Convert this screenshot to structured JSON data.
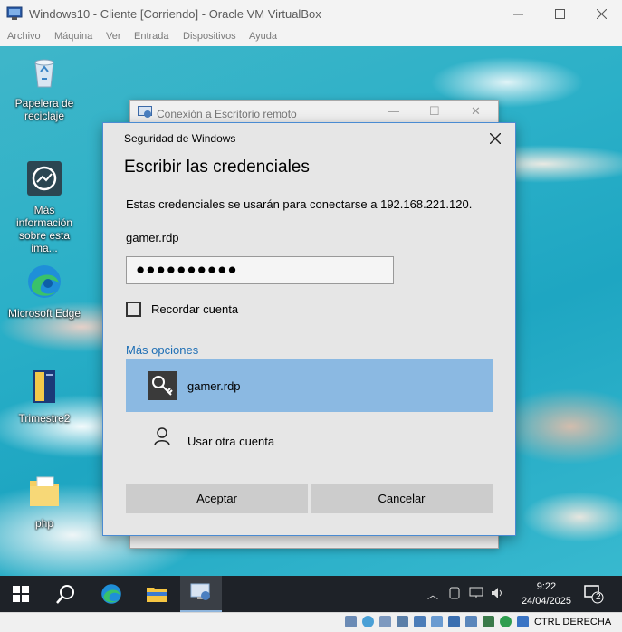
{
  "vbox": {
    "title": "Windows10 - Cliente [Corriendo] - Oracle VM VirtualBox",
    "menu": [
      "Archivo",
      "Máquina",
      "Ver",
      "Entrada",
      "Dispositivos",
      "Ayuda"
    ],
    "status_label": "CTRL DERECHA"
  },
  "desktop_icons": [
    {
      "label": "Papelera de reciclaje",
      "icon": "recycle-bin-icon"
    },
    {
      "label": "Más información sobre esta ima...",
      "icon": "info-camera-icon"
    },
    {
      "label": "Microsoft Edge",
      "icon": "edge-icon"
    },
    {
      "label": "Trimestre2",
      "icon": "document-icon"
    },
    {
      "label": "php",
      "icon": "folder-icon"
    }
  ],
  "rdp_window": {
    "title": "Conexión a Escritorio remoto"
  },
  "dialog": {
    "small_title": "Seguridad de Windows",
    "heading": "Escribir las credenciales",
    "description": "Estas credenciales se usarán para conectarse a 192.168.221.120.",
    "username": "gamer.rdp",
    "password_masked": "●●●●●●●●●●",
    "remember_label": "Recordar cuenta",
    "remember_checked": false,
    "more_options": "Más opciones",
    "selected_account": "gamer.rdp",
    "other_account": "Usar otra cuenta",
    "ok_label": "Aceptar",
    "cancel_label": "Cancelar",
    "accent_color": "#8bb9e2"
  },
  "taskbar": {
    "time": "9:22",
    "date": "24/04/2025",
    "notifications": "2"
  }
}
